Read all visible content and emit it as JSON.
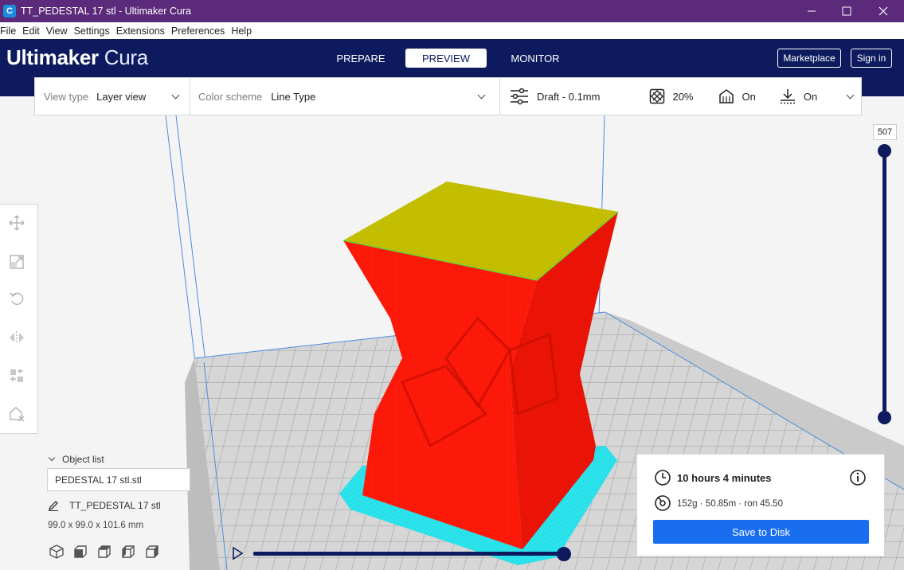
{
  "window": {
    "title": "TT_PEDESTAL 17 stl - Ultimaker Cura",
    "app_icon": "C"
  },
  "menu": [
    "File",
    "Edit",
    "View",
    "Settings",
    "Extensions",
    "Preferences",
    "Help"
  ],
  "header": {
    "logo_bold": "Ultimaker",
    "logo_light": " Cura",
    "tabs": [
      "PREPARE",
      "PREVIEW",
      "MONITOR"
    ],
    "active_tab": "PREVIEW",
    "marketplace_label": "Marketplace",
    "signin_label": "Sign in"
  },
  "toolbar": {
    "view_type_label": "View type",
    "view_type_value": "Layer view",
    "color_scheme_label": "Color scheme",
    "color_scheme_value": "Line Type",
    "profile": "Draft - 0.1mm",
    "infill": "20%",
    "support": "On",
    "adhesion": "On"
  },
  "layer_slider": {
    "current_layer": "507"
  },
  "object_list": {
    "title": "Object list",
    "input_value": "PEDESTAL 17 stl.stl",
    "object_name": "TT_PEDESTAL 17 stl",
    "dimensions": "99.0 x 99.0 x 101.6 mm"
  },
  "print_info": {
    "time": "10 hours 4 minutes",
    "material": "152g · 50.85m · ron 45.50",
    "save_label": "Save to Disk"
  },
  "colors": {
    "title_bar": "#5b2a7a",
    "header": "#0d1a5e",
    "model_wall": "#ff1a0a",
    "model_top": "#c8c300",
    "brim": "#2ee8f0",
    "save_button": "#196ef0"
  }
}
